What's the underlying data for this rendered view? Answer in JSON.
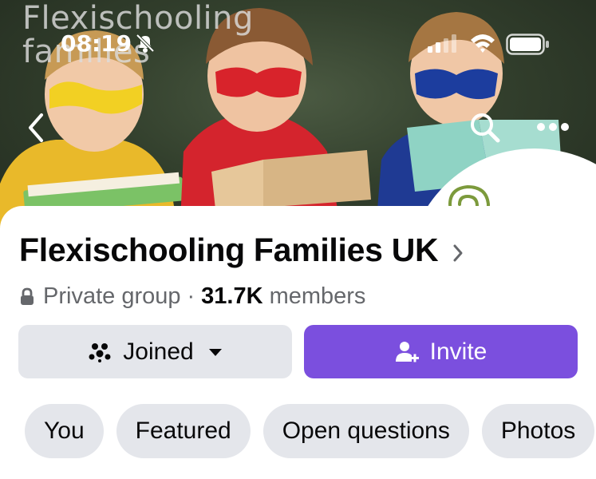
{
  "status_bar": {
    "time": "08:19",
    "icons": [
      "bell-slash-icon",
      "signal-icon",
      "wifi-icon",
      "battery-icon"
    ]
  },
  "cover": {
    "watermark_line1": "Flexischooling",
    "watermark_line2": "families",
    "buttons": [
      "back-icon",
      "search-icon",
      "more-icon"
    ]
  },
  "group": {
    "name": "Flexischooling Families UK",
    "privacy": "Private group",
    "separator": "·",
    "member_count": "31.7K",
    "member_label": "members"
  },
  "actions": {
    "joined_label": "Joined",
    "invite_label": "Invite"
  },
  "chips": [
    "You",
    "Featured",
    "Open questions",
    "Photos"
  ],
  "colors": {
    "invite_bg": "#7b4fde",
    "button_bg": "#e4e6eb",
    "text_primary": "#080809",
    "text_secondary": "#65676b"
  }
}
